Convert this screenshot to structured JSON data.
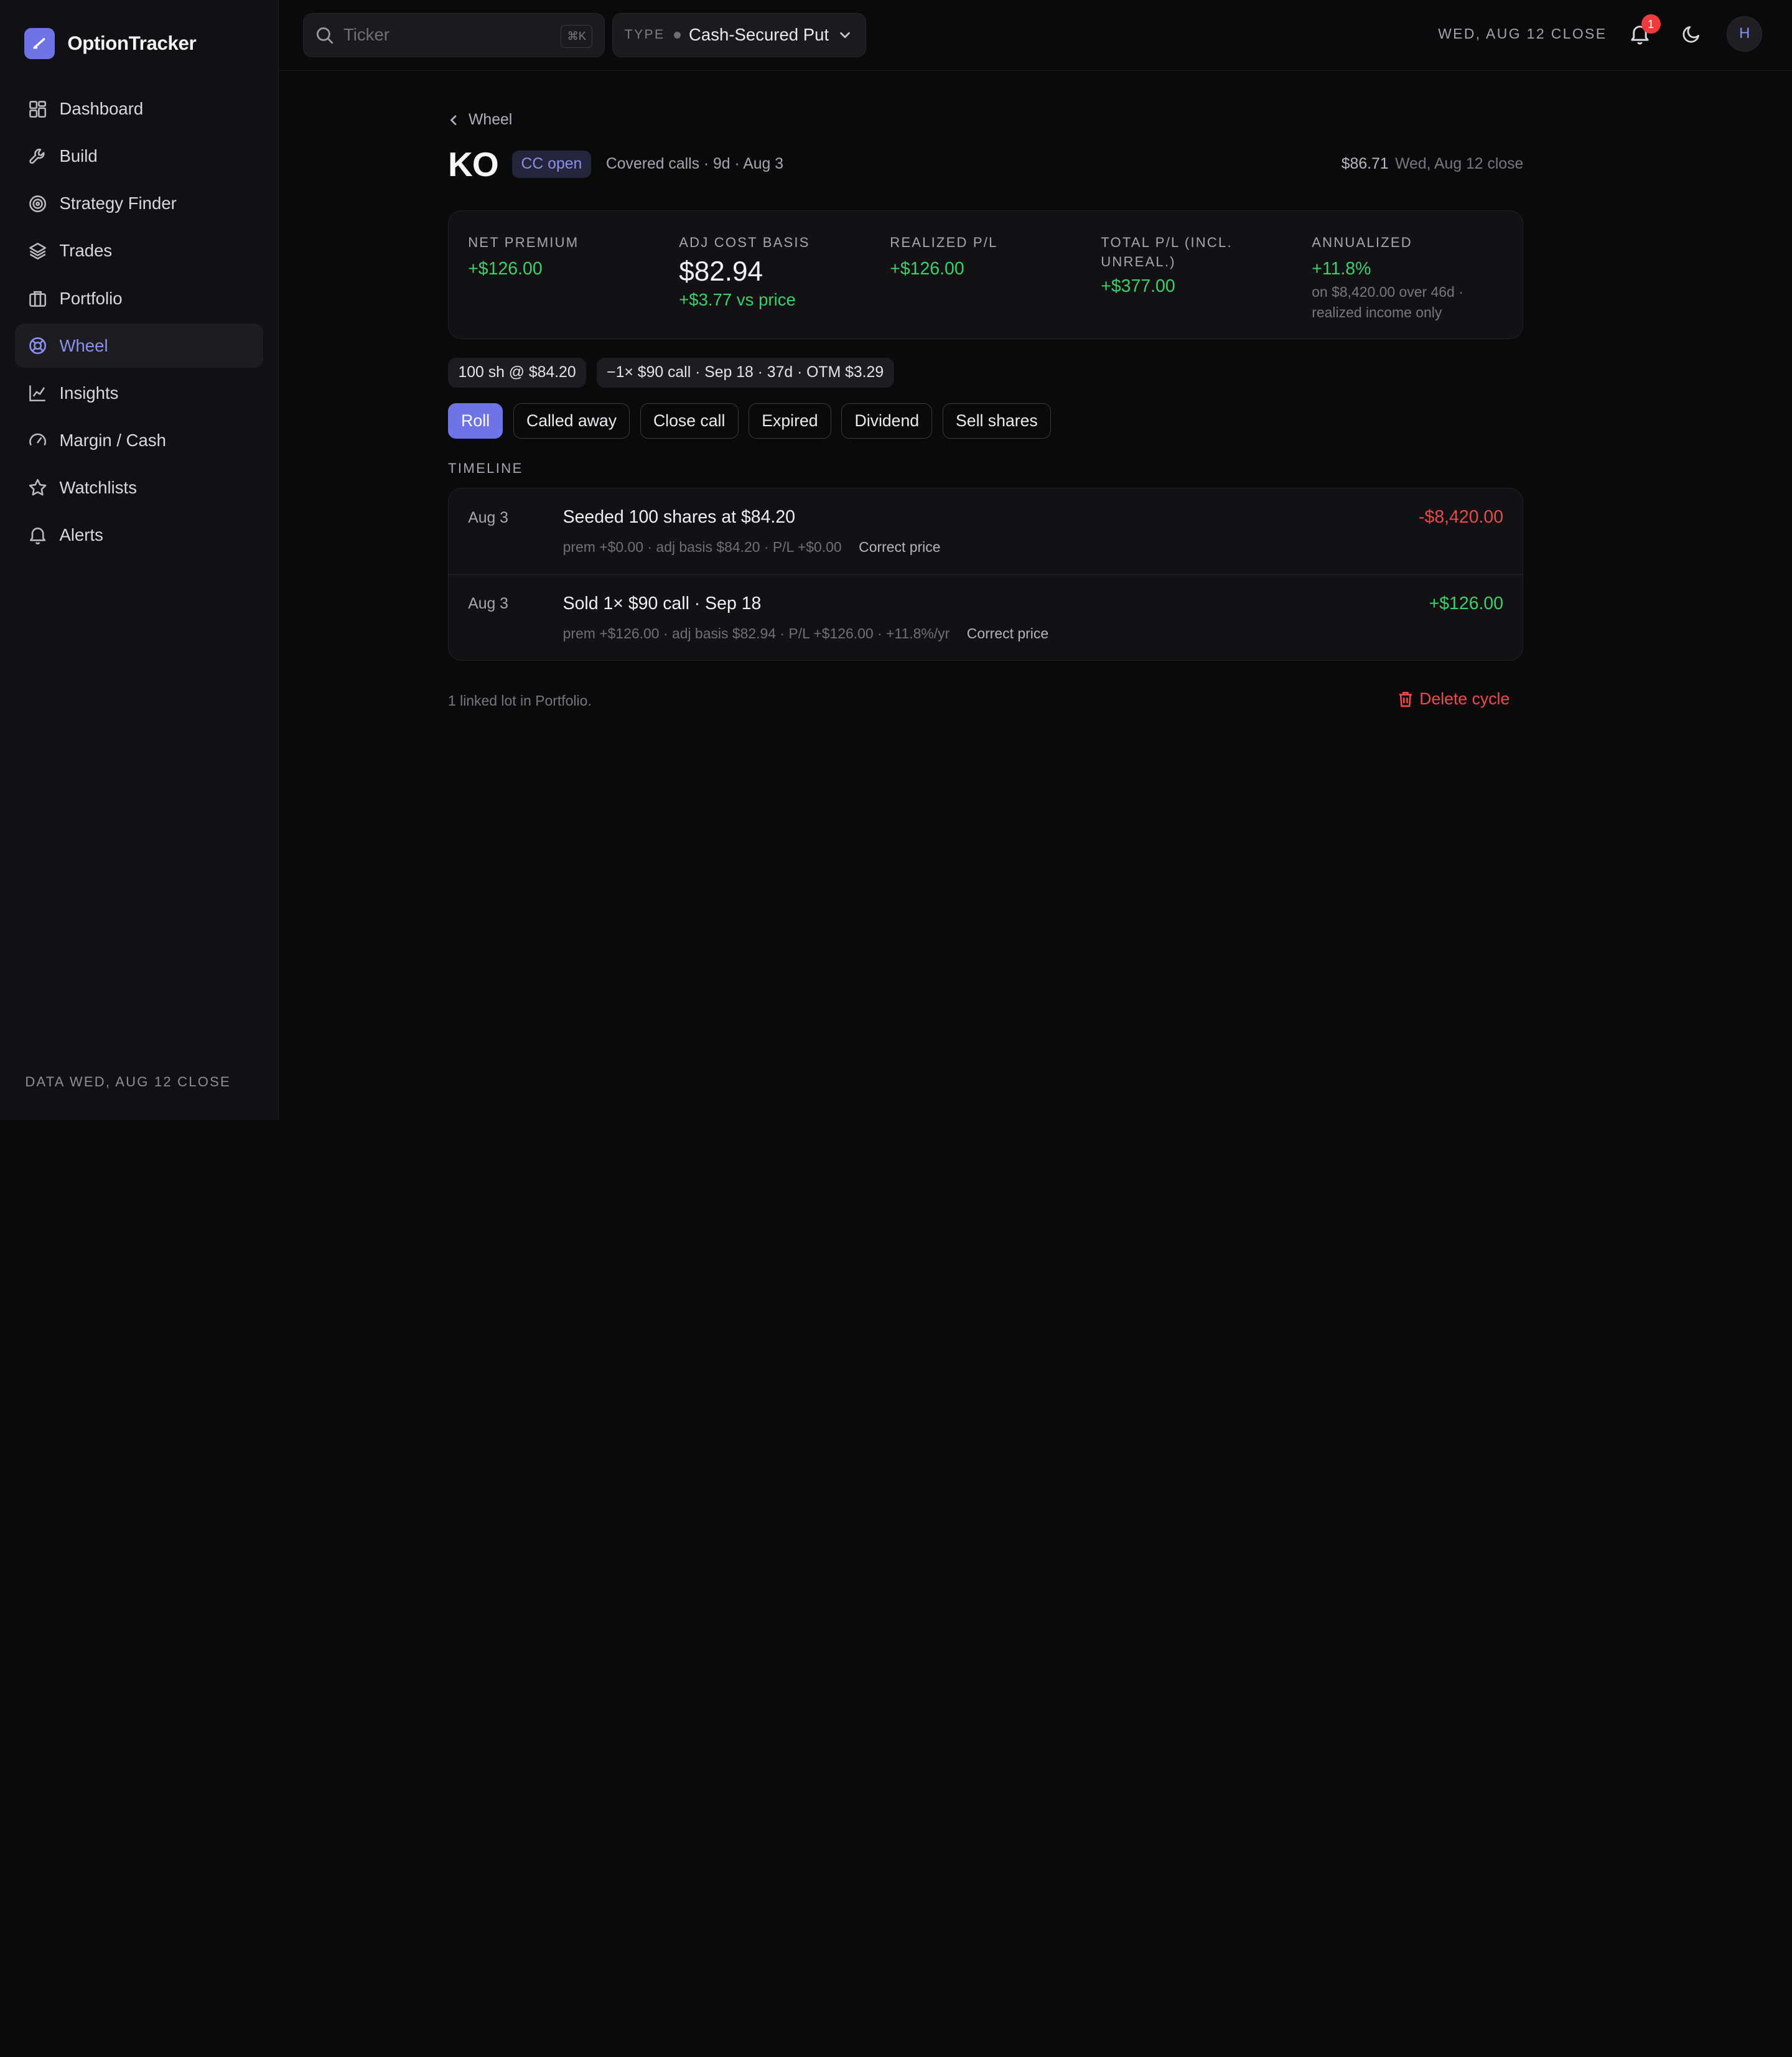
{
  "app": {
    "name": "OptionTracker"
  },
  "sidebar": {
    "items": [
      {
        "label": "Dashboard",
        "icon": "dashboard-icon"
      },
      {
        "label": "Build",
        "icon": "wrench-icon"
      },
      {
        "label": "Strategy Finder",
        "icon": "target-icon"
      },
      {
        "label": "Trades",
        "icon": "layers-icon"
      },
      {
        "label": "Portfolio",
        "icon": "briefcase-icon"
      },
      {
        "label": "Wheel",
        "icon": "lifebuoy-icon",
        "active": true
      },
      {
        "label": "Insights",
        "icon": "chart-line-icon"
      },
      {
        "label": "Margin / Cash",
        "icon": "gauge-icon"
      },
      {
        "label": "Watchlists",
        "icon": "star-icon"
      },
      {
        "label": "Alerts",
        "icon": "bell-icon"
      }
    ],
    "footer": "DATA WED, AUG 12 CLOSE"
  },
  "topbar": {
    "search_placeholder": "Ticker",
    "search_shortcut": "⌘K",
    "type_label": "TYPE",
    "type_value": "Cash-Secured Put",
    "close_label": "WED, AUG 12 CLOSE",
    "notifications_count": "1",
    "avatar_initial": "H"
  },
  "page": {
    "breadcrumb": "Wheel",
    "ticker": "KO",
    "status": "CC open",
    "subtitle": "Covered calls · 9d · Aug 3",
    "price": "$86.71",
    "price_date": "Wed, Aug 12 close"
  },
  "stats": {
    "net_premium": {
      "label": "NET PREMIUM",
      "value": "+$126.00"
    },
    "adj_cost_basis": {
      "label": "ADJ COST BASIS",
      "value": "$82.94",
      "sub": "+$3.77 vs price"
    },
    "realized_pl": {
      "label": "REALIZED P/L",
      "value": "+$126.00"
    },
    "total_pl": {
      "label": "TOTAL P/L (INCL. UNREAL.)",
      "value": "+$377.00"
    },
    "annualized": {
      "label": "ANNUALIZED",
      "value": "+11.8%",
      "note": "on $8,420.00 over 46d · realized income only"
    }
  },
  "chips": [
    "100 sh @ $84.20",
    "−1× $90 call · Sep 18 · 37d · OTM $3.29"
  ],
  "actions": [
    "Roll",
    "Called away",
    "Close call",
    "Expired",
    "Dividend",
    "Sell shares"
  ],
  "timeline": {
    "title": "TIMELINE",
    "rows": [
      {
        "date": "Aug 3",
        "title": "Seeded 100 shares at $84.20",
        "meta": "prem +$0.00 · adj basis $84.20 · P/L +$0.00",
        "link": "Correct price",
        "amount": "-$8,420.00"
      },
      {
        "date": "Aug 3",
        "title": "Sold 1× $90 call · Sep 18",
        "meta": "prem +$126.00 · adj basis $82.94 · P/L +$126.00 · +11.8%/yr",
        "link": "Correct price",
        "amount": "+$126.00"
      }
    ]
  },
  "footer": {
    "linked_note": "1 linked lot in Portfolio.",
    "delete_label": "Delete cycle"
  },
  "colors": {
    "accent": "#6e74e6",
    "positive": "#3fce6c",
    "negative": "#e64a4a",
    "background": "#0a0a0b"
  }
}
